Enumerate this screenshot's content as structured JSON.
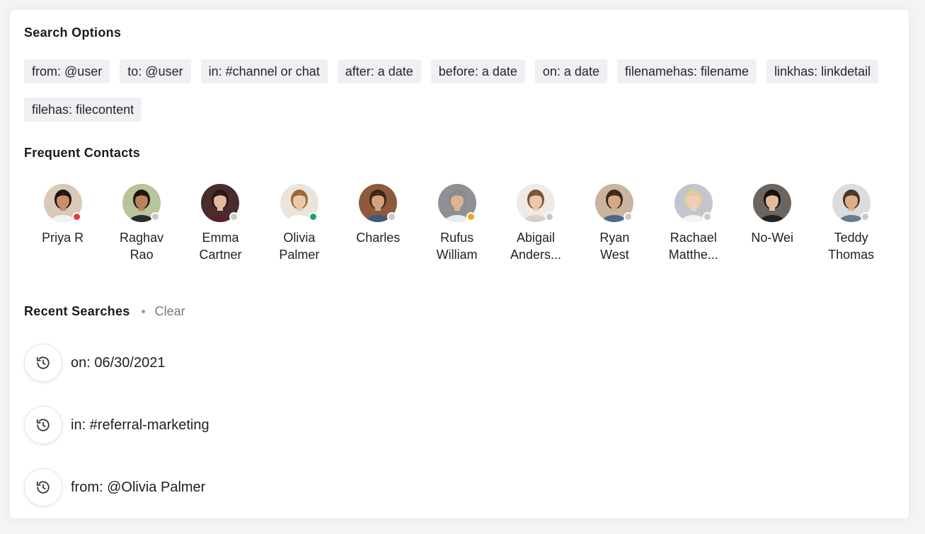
{
  "search_options": {
    "title": "Search Options",
    "chips": [
      "from: @user",
      "to: @user",
      "in: #channel or chat",
      "after: a date",
      "before: a date",
      "on: a date",
      "filenamehas: filename",
      "linkhas: linkdetail",
      "filehas: filecontent"
    ]
  },
  "frequent_contacts": {
    "title": "Frequent Contacts",
    "contacts": [
      {
        "line1": "Priya R",
        "line2": "",
        "status_color": "#e8393b",
        "bg": "#d9c9b8",
        "skin": "#c98f6a",
        "hair": "#1e1410",
        "shirt": "#f2f2f2"
      },
      {
        "line1": "Raghav",
        "line2": "Rao",
        "status_color": "#c8c8c8",
        "bg": "#b8c49a",
        "skin": "#b98261",
        "hair": "#1b1512",
        "shirt": "#2b2b2e"
      },
      {
        "line1": "Emma",
        "line2": "Cartner",
        "status_color": "#c8c8c8",
        "bg": "#4a2b2e",
        "skin": "#e3b9a0",
        "hair": "#2a1714",
        "shirt": "#5a1f2a"
      },
      {
        "line1": "Olivia",
        "line2": "Palmer",
        "status_color": "#19a463",
        "bg": "#e9e4dc",
        "skin": "#edc9aa",
        "hair": "#9b6a3c",
        "shirt": "#ffffff"
      },
      {
        "line1": "Charles",
        "line2": "",
        "status_color": "#c8c8c8",
        "bg": "#8d5a3e",
        "skin": "#d6a27e",
        "hair": "#3a2618",
        "shirt": "#3e5a7a"
      },
      {
        "line1": "Rufus",
        "line2": "William",
        "status_color": "#f4a31c",
        "bg": "#8f9096",
        "skin": "#deb294",
        "hair": "#8a8a8a",
        "shirt": "#e9ecf0"
      },
      {
        "line1": "Abigail",
        "line2": "Anders...",
        "status_color": "#c8c8c8",
        "bg": "#efeae6",
        "skin": "#ecc6aa",
        "hair": "#7a5236",
        "shirt": "#d9cfc6"
      },
      {
        "line1": "Ryan",
        "line2": "West",
        "status_color": "#c8c8c8",
        "bg": "#c9b49f",
        "skin": "#d9a783",
        "hair": "#3a2a1e",
        "shirt": "#4e6a86"
      },
      {
        "line1": "Rachael",
        "line2": "Matthe...",
        "status_color": "#c8c8c8",
        "bg": "#c2c6cc",
        "skin": "#f0cfb6",
        "hair": "#e2cc96",
        "shirt": "#f5f5f5"
      },
      {
        "line1": "No-Wei",
        "line2": "",
        "status_color": "",
        "bg": "#6a6560",
        "skin": "#e4bb9a",
        "hair": "#141010",
        "shirt": "#222222"
      },
      {
        "line1": "Teddy",
        "line2": "Thomas",
        "status_color": "#c8c8c8",
        "bg": "#dcdcdc",
        "skin": "#dcae8c",
        "hair": "#4b3526",
        "shirt": "#6a7b8c"
      }
    ]
  },
  "recent_searches": {
    "title": "Recent Searches",
    "clear_label": "Clear",
    "items": [
      "on: 06/30/2021",
      "in: #referral-marketing",
      "from: @Olivia Palmer"
    ]
  }
}
